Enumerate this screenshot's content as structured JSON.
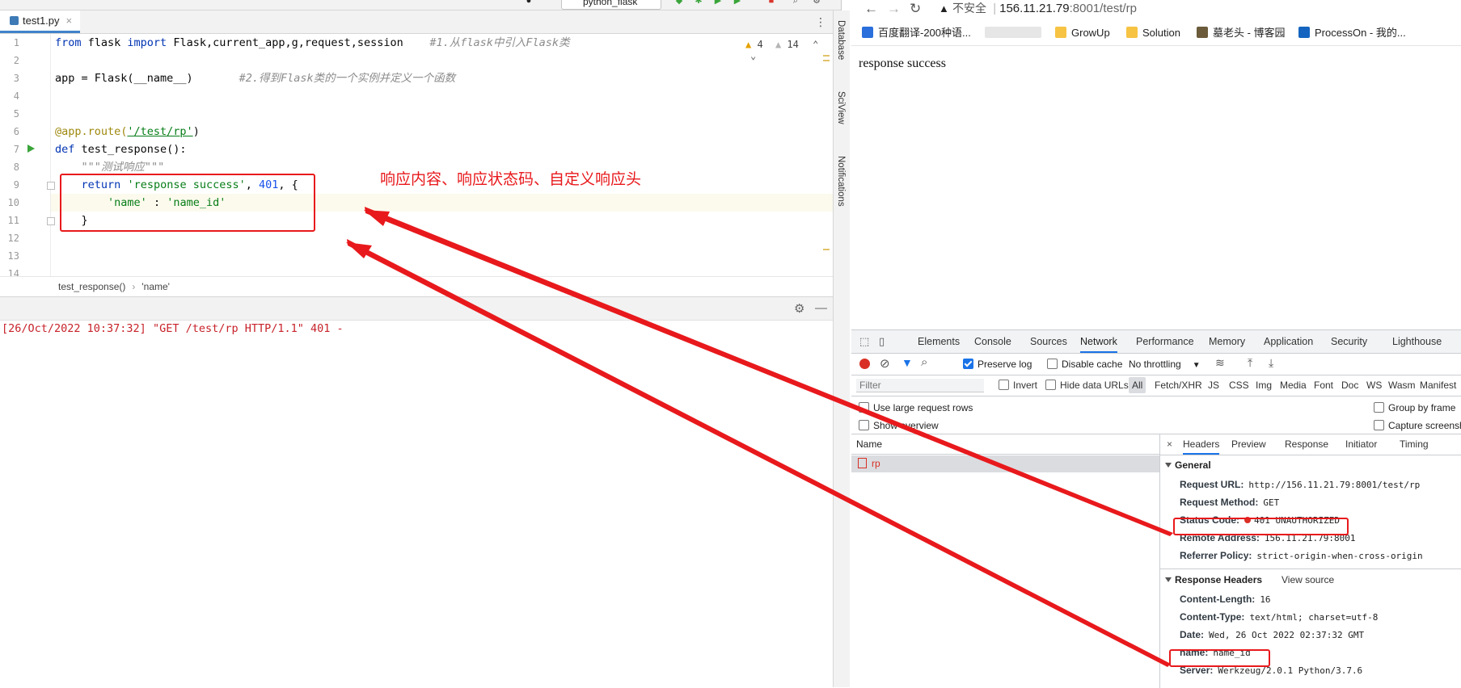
{
  "ide": {
    "run_config": "python_flask",
    "file_tab": "test1.py",
    "file_tab_close": "×",
    "tab_menu": "⋮",
    "warnings": {
      "warn_count": "4",
      "weak_count": "14"
    },
    "line_numbers": [
      "1",
      "2",
      "3",
      "4",
      "5",
      "6",
      "7",
      "8",
      "9",
      "10",
      "11",
      "12",
      "13",
      "14"
    ],
    "code": {
      "l1_from": "from",
      "l1_mod": " flask ",
      "l1_import": "import",
      "l1_rest": " Flask,current_app,g,request,session",
      "l1_comment": "#1.从flask中引入Flask类",
      "l3_code": "app = Flask(__name__)",
      "l3_comment": "#2.得到Flask类的一个实例并定义一个函数",
      "l6_dec": "@app.route(",
      "l6_str": "'/test/rp'",
      "l6_end": ")",
      "l7_def": "def",
      "l7_rest": " test_response():",
      "l8_doc": "\"\"\"测试响应\"\"\"",
      "l9_return": "return",
      "l9_str": "'response success'",
      "l9_comma": ", ",
      "l9_num": "401",
      "l9_end": ", {",
      "l10_key": "'name'",
      "l10_colon": " : ",
      "l10_val": "'name_id'",
      "l11_brace": "}"
    },
    "breadcrumb": [
      "test_response()",
      "'name'"
    ],
    "breadcrumb_sep": "›",
    "console": {
      "timestamp": "[26/Oct/2022 10:37:32]",
      "request": "\"GET /test/rp HTTP/1.1\"",
      "status": " 401 -"
    },
    "side_tabs": [
      "Database",
      "SciView",
      "Notifications"
    ]
  },
  "annotation": {
    "text": "响应内容、响应状态码、自定义响应头"
  },
  "browser": {
    "nav": {
      "back": "←",
      "forward": "→",
      "reload": "↻"
    },
    "address": {
      "warning": "不安全",
      "host": "156.11.21.79",
      "path": ":8001/test/rp"
    },
    "bookmarks": [
      {
        "label": "百度翻译-200种语...",
        "color": "#2a6fdb"
      },
      {
        "label": "",
        "color": "#e6e6e6"
      },
      {
        "label": "GrowUp",
        "color": "#f6c343"
      },
      {
        "label": "Solution",
        "color": "#f6c343"
      },
      {
        "label": "墓老头 - 博客园",
        "color": "#6b5b3a"
      },
      {
        "label": "ProcessOn - 我的...",
        "color": "#1565c0"
      }
    ],
    "page_text": "response success"
  },
  "devtools": {
    "tabs": [
      "Elements",
      "Console",
      "Sources",
      "Network",
      "Performance",
      "Memory",
      "Application",
      "Security",
      "Lighthouse"
    ],
    "active_tab": "Network",
    "toolbar": {
      "preserve_log": "Preserve log",
      "disable_cache": "Disable cache",
      "throttling": "No throttling"
    },
    "filter": {
      "placeholder": "Filter",
      "invert": "Invert",
      "hide_data_urls": "Hide data URLs",
      "types": [
        "All",
        "Fetch/XHR",
        "JS",
        "CSS",
        "Img",
        "Media",
        "Font",
        "Doc",
        "WS",
        "Wasm",
        "Manifest"
      ]
    },
    "options": {
      "large_rows": "Use large request rows",
      "show_overview": "Show overview",
      "group_by_frame": "Group by frame",
      "capture_screenshots": "Capture screenshots"
    },
    "list": {
      "header": "Name",
      "rows": [
        "rp"
      ]
    },
    "detail": {
      "close": "×",
      "tabs": [
        "Headers",
        "Preview",
        "Response",
        "Initiator",
        "Timing"
      ],
      "general_title": "General",
      "general": [
        {
          "k": "Request URL:",
          "v": "http://156.11.21.79:8001/test/rp"
        },
        {
          "k": "Request Method:",
          "v": "GET"
        },
        {
          "k": "Status Code:",
          "v": "401 UNAUTHORIZED"
        },
        {
          "k": "Remote Address:",
          "v": "156.11.21.79:8001"
        },
        {
          "k": "Referrer Policy:",
          "v": "strict-origin-when-cross-origin"
        }
      ],
      "response_title": "Response Headers",
      "view_source": "View source",
      "response": [
        {
          "k": "Content-Length:",
          "v": "16"
        },
        {
          "k": "Content-Type:",
          "v": "text/html; charset=utf-8"
        },
        {
          "k": "Date:",
          "v": "Wed, 26 Oct 2022 02:37:32 GMT"
        },
        {
          "k": "name:",
          "v": "name_id"
        },
        {
          "k": "Server:",
          "v": "Werkzeug/2.0.1 Python/3.7.6"
        }
      ]
    }
  },
  "colors": {
    "annotation_red": "#e8191c",
    "status_red": "#d93025",
    "active_blue": "#1a73e8"
  }
}
